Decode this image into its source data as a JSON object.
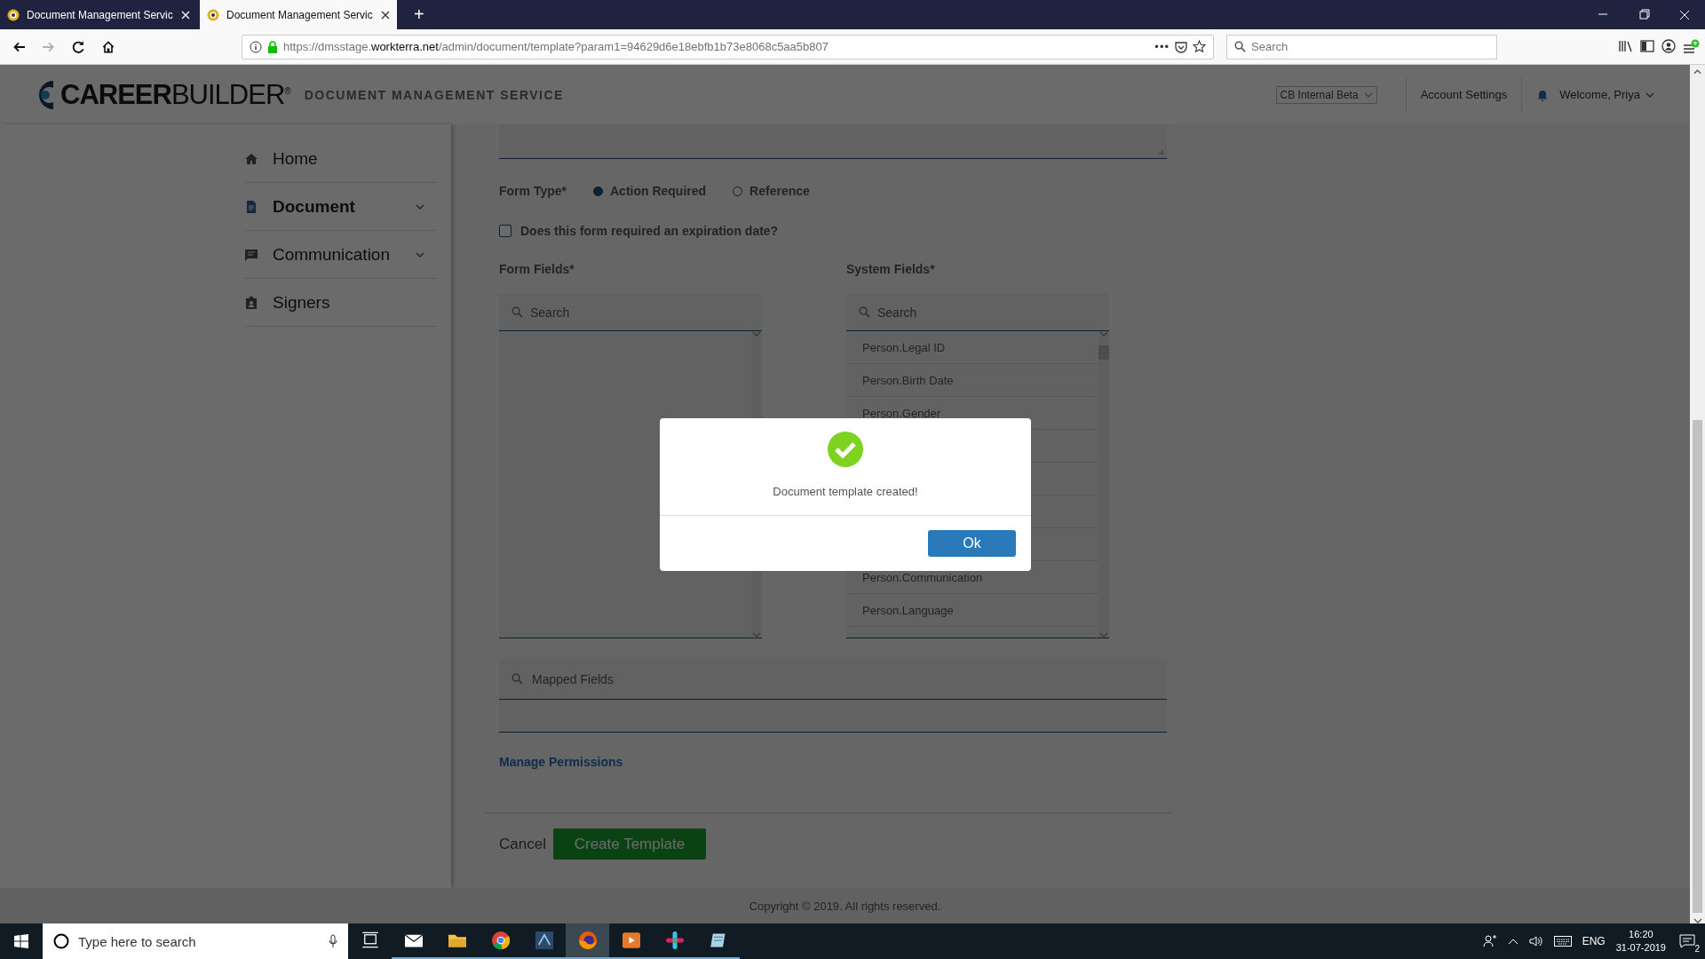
{
  "browser": {
    "tabs": [
      {
        "title": "Document Management Servic",
        "selected": false
      },
      {
        "title": "Document Management Servic",
        "selected": true
      }
    ],
    "new_tab": "+",
    "nav_buttons": [
      {
        "kind": "back",
        "disabled": false
      },
      {
        "kind": "forward",
        "disabled": true
      },
      {
        "kind": "reload",
        "disabled": false
      },
      {
        "kind": "home",
        "disabled": false
      }
    ],
    "url": {
      "prefix": "https://dmsstage.",
      "domain": "workterra.net",
      "path": "/admin/document/template?param1=94629d6e18ebfb1b73e8068c5aa5b807"
    },
    "more": "•••",
    "search": {
      "placeholder": "Search"
    }
  },
  "header": {
    "brand": "**CAREER**BUILDER$^{®}$",
    "service": "DOCUMENT MANAGEMENT SERVICE",
    "environment": "CB Internal Beta",
    "account": "Account Settings",
    "welcome": "Welcome, Priya"
  },
  "sidebar": [
    {
      "kind": "home",
      "label": "Home",
      "selected": false,
      "expandable": false
    },
    {
      "kind": "document",
      "label": "Document",
      "selected": true,
      "expandable": true
    },
    {
      "kind": "communication",
      "label": "Communication",
      "selected": false,
      "expandable": true
    },
    {
      "kind": "signers",
      "label": "Signers",
      "selected": false,
      "expandable": false
    }
  ],
  "form": {
    "form_type": {
      "label": "Form Type*",
      "options": [
        {
          "label": "Action Required",
          "selected": true
        },
        {
          "label": "Reference",
          "selected": false
        }
      ]
    },
    "expiration": {
      "label": "Does this form required an expiration date?",
      "checked": false
    },
    "form_fields": {
      "label": "Form Fields*",
      "search": {
        "placeholder": "Search"
      }
    },
    "system_fields": {
      "label": "System Fields*",
      "search": {
        "placeholder": "Search"
      },
      "items": [
        {
          "label": "Person.Legal ID"
        },
        {
          "label": "Person.Birth Date"
        },
        {
          "label": "Person.Gender"
        }
      ],
      "items_below_dialog": [
        {
          "label": "Person.Communication"
        },
        {
          "label": "Person.Language"
        }
      ]
    },
    "mapped_fields": {
      "placeholder": "Mapped Fields"
    },
    "manage_permissions": "Manage Permissions",
    "cancel": "Cancel",
    "submit": "Create Template"
  },
  "footer": "Copyright © 2019. All rights reserved.",
  "dialog": {
    "message": "Document template created!",
    "ok": "Ok"
  },
  "taskbar": {
    "search": {
      "placeholder": "Type here to search"
    },
    "apps": [
      {
        "kind": "task-view",
        "selected": false
      },
      {
        "kind": "mail",
        "selected": false
      },
      {
        "kind": "folder",
        "selected": false
      },
      {
        "kind": "chrome",
        "selected": false
      },
      {
        "kind": "editor",
        "selected": false
      },
      {
        "kind": "firefox",
        "selected": true
      },
      {
        "kind": "media",
        "selected": false
      },
      {
        "kind": "slack",
        "selected": false
      },
      {
        "kind": "notepad",
        "selected": false
      }
    ],
    "lang": "ENG",
    "time": "16:20",
    "date": "31-07-2019",
    "notifications": "2"
  }
}
